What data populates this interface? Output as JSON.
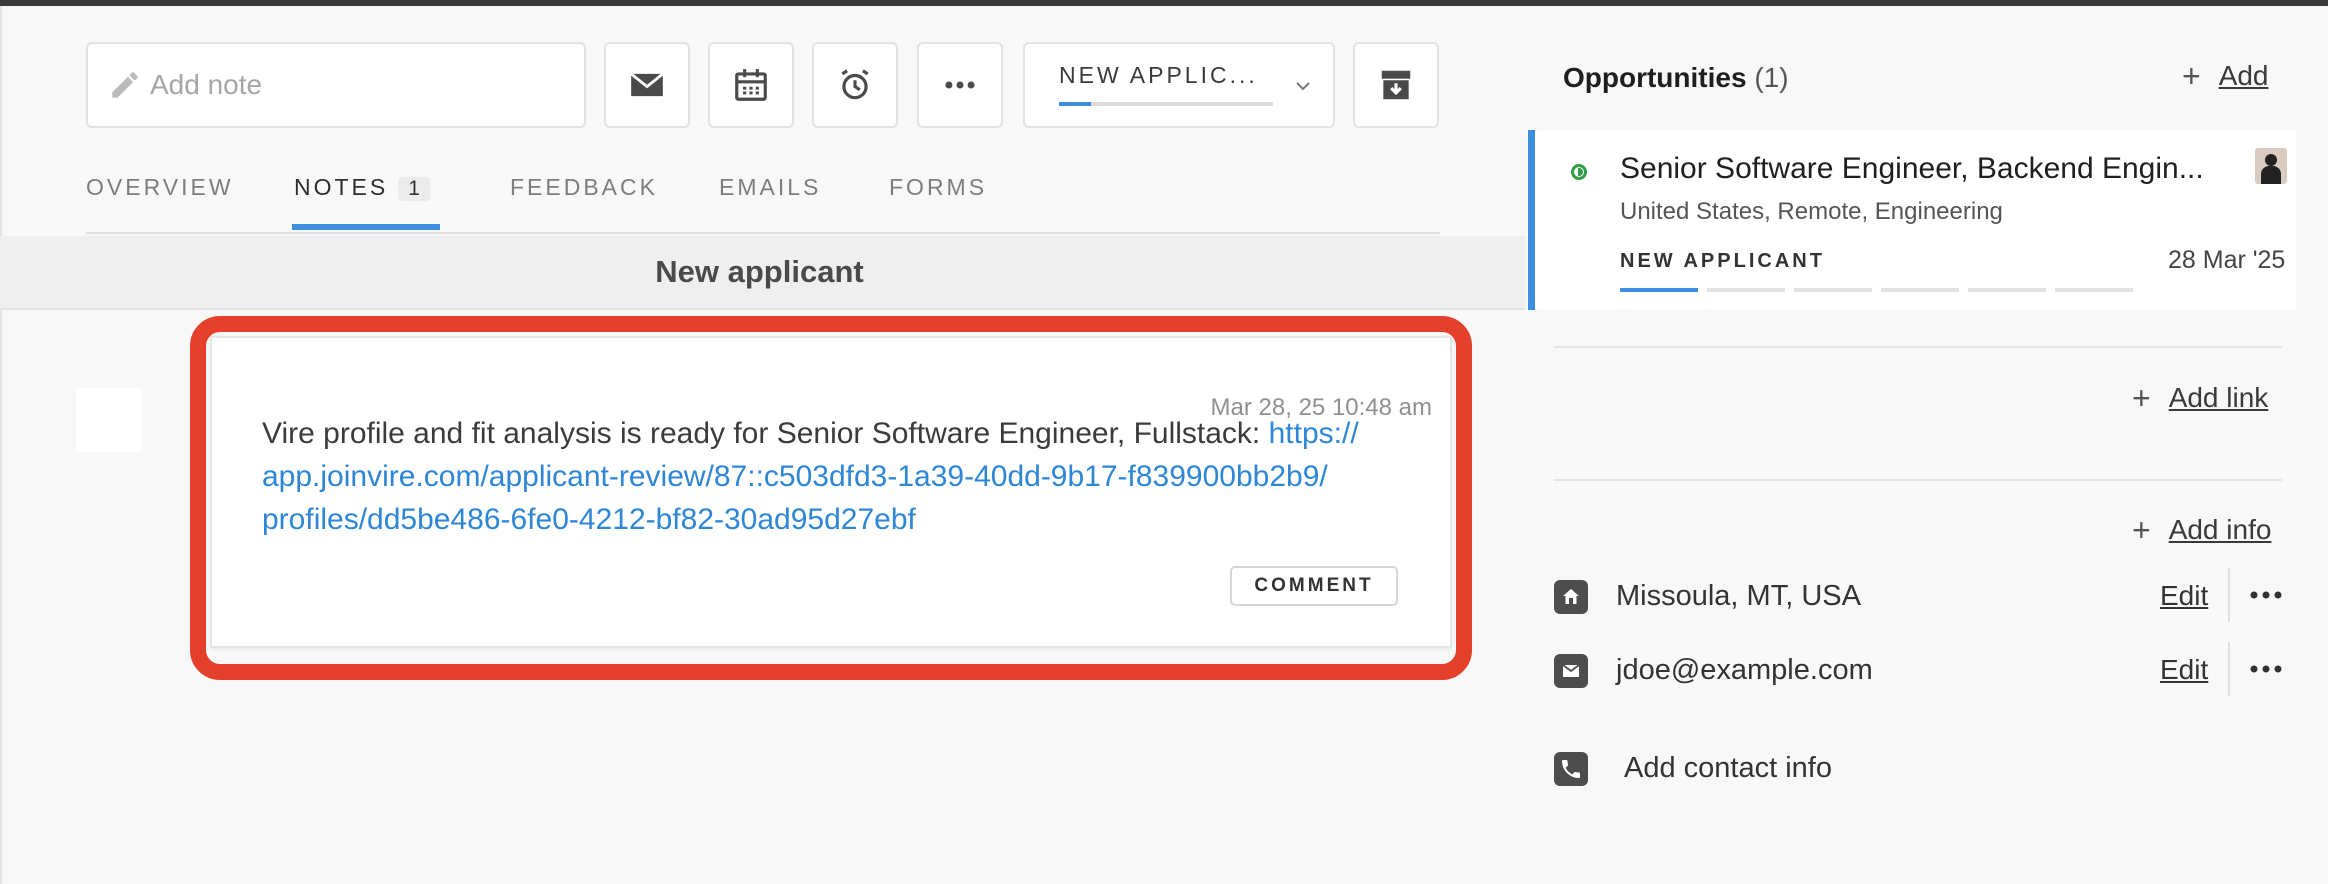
{
  "toolbar": {
    "note_placeholder": "Add note",
    "stage_label": "NEW APPLIC...",
    "stage_progress": 0.15
  },
  "tabs": [
    {
      "label": "OVERVIEW"
    },
    {
      "label": "NOTES",
      "count": "1"
    },
    {
      "label": "FEEDBACK"
    },
    {
      "label": "EMAILS"
    },
    {
      "label": "FORMS"
    }
  ],
  "stage_header": "New applicant",
  "note": {
    "timestamp": "Mar 28, 25 10:48 am",
    "text": "Vire profile and fit analysis is ready for Senior Software Engineer, Fullstack: ",
    "link_line1": "https://",
    "link_line2": "app.joinvire.com/applicant-review/87::c503dfd3-1a39-40dd-9b17-f839900bb2b9/",
    "link_line3": "profiles/dd5be486-6fe0-4212-bf82-30ad95d27ebf",
    "comment_label": "COMMENT"
  },
  "opportunities": {
    "title": "Opportunities",
    "count": "(1)",
    "add_label": "Add",
    "card": {
      "title": "Senior Software Engineer, Backend Engin...",
      "subtitle": "United States, Remote, Engineering",
      "stage": "NEW APPLICANT",
      "date": "28 Mar '25",
      "stage_step": 1,
      "stage_total": 6
    }
  },
  "links": {
    "add_label": "Add link"
  },
  "info": {
    "add_label": "Add info",
    "location": "Missoula, MT, USA",
    "email": "jdoe@example.com",
    "edit_label": "Edit",
    "add_contact_label": "Add contact info"
  },
  "colors": {
    "accent": "#3b8fe0",
    "highlight": "#e4402b",
    "link": "#2e86d6",
    "status_green": "#2f9e47"
  }
}
